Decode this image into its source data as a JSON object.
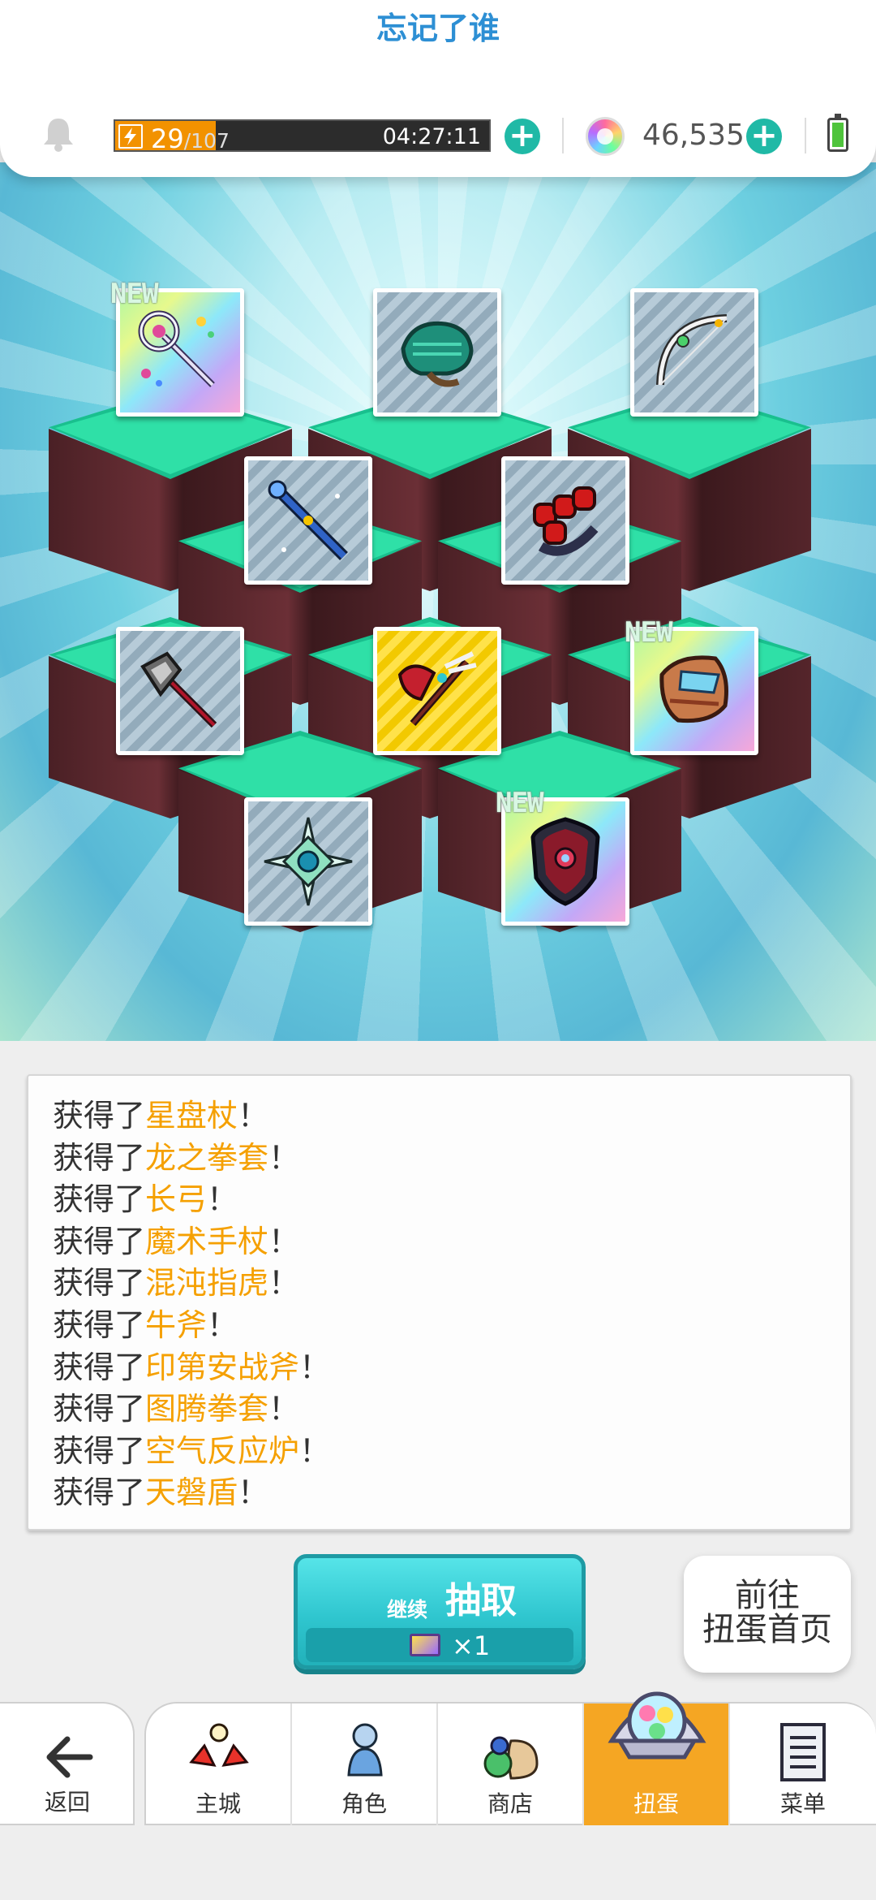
{
  "header": {
    "player_name": "忘记了谁",
    "stamina_current": "29",
    "stamina_max": "/107",
    "stamina_fraction": 0.27,
    "stamina_timer": "04:27:11",
    "gems": "46,535",
    "plus": "+"
  },
  "cards": [
    {
      "item": "星盘杖",
      "new": true
    },
    {
      "item": "龙之拳套",
      "new": false
    },
    {
      "item": "长弓",
      "new": false
    },
    {
      "item": "魔术手杖",
      "new": false
    },
    {
      "item": "混沌指虎",
      "new": false
    },
    {
      "item": "牛斧",
      "new": false
    },
    {
      "item": "印第安战斧",
      "new": false
    },
    {
      "item": "图腾拳套",
      "new": true
    },
    {
      "item": "空气反应炉",
      "new": false
    },
    {
      "item": "天磐盾",
      "new": true
    }
  ],
  "new_label": "NEW",
  "log": {
    "prefix": "获得了",
    "suffix": "！",
    "items": [
      "星盘杖",
      "龙之拳套",
      "长弓",
      "魔术手杖",
      "混沌指虎",
      "牛斧",
      "印第安战斧",
      "图腾拳套",
      "空气反应炉",
      "天磐盾"
    ]
  },
  "actions": {
    "continue_small": "继续",
    "continue_big": "抽取",
    "continue_cost": "×1",
    "goto_line1": "前往",
    "goto_line2": "扭蛋首页"
  },
  "nav": {
    "back": "返回",
    "tabs": [
      "主城",
      "角色",
      "商店",
      "扭蛋",
      "菜单"
    ],
    "active_tab": "扭蛋"
  }
}
